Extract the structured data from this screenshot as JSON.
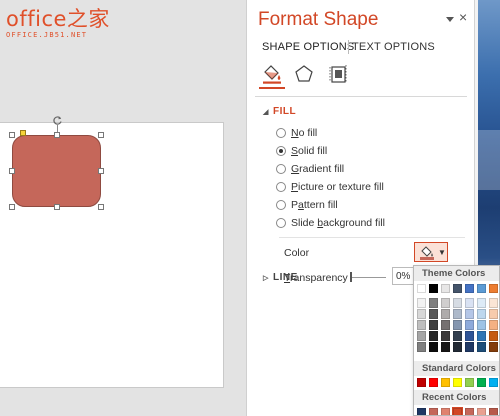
{
  "watermark": {
    "main": "office之家",
    "sub": "OFFICE.JB51.NET"
  },
  "pane": {
    "title": "Format Shape",
    "close_glyph": "×",
    "tabs": [
      {
        "label": "SHAPE OPTIONS",
        "active": true
      },
      {
        "label": "TEXT OPTIONS",
        "active": false
      }
    ],
    "category_icons": [
      "fill-line-icon",
      "effects-pentagon-icon",
      "size-properties-icon"
    ]
  },
  "fill": {
    "heading": "FILL",
    "options": [
      {
        "pre": "",
        "u": "N",
        "post": "o fill",
        "selected": false
      },
      {
        "pre": "",
        "u": "S",
        "post": "olid fill",
        "selected": true
      },
      {
        "pre": "",
        "u": "G",
        "post": "radient fill",
        "selected": false
      },
      {
        "pre": "",
        "u": "P",
        "post": "icture or texture fill",
        "selected": false
      },
      {
        "pre": "P",
        "u": "a",
        "post": "ttern fill",
        "selected": false
      },
      {
        "pre": "Slide ",
        "u": "b",
        "post": "ackground fill",
        "selected": false
      }
    ],
    "color_label": "Color",
    "transparency": {
      "label_u": "T",
      "label_rest": "ransparency",
      "value": "0%",
      "level": 0
    }
  },
  "line": {
    "heading": "LINE"
  },
  "picker": {
    "theme_heading": "Theme Colors",
    "standard_heading": "Standard Colors",
    "recent_heading": "Recent Colors",
    "theme_top": [
      "#ffffff",
      "#000000",
      "#e7e6e6",
      "#44546a",
      "#4472c4",
      "#5b9bd5",
      "#ed7d31"
    ],
    "theme_shades": [
      [
        "#f2f2f2",
        "#7f7f7f",
        "#d0cece",
        "#d6dce4",
        "#d9e2f3",
        "#ddebf7",
        "#fbe5d5"
      ],
      [
        "#d8d8d8",
        "#595959",
        "#aeabab",
        "#adb9ca",
        "#b4c6e7",
        "#bdd7ee",
        "#f7cbac"
      ],
      [
        "#bfbfbf",
        "#3f3f3f",
        "#757070",
        "#8496b0",
        "#8eaadb",
        "#9dc3e6",
        "#f4b183"
      ],
      [
        "#a5a5a5",
        "#262626",
        "#3a3838",
        "#323f4f",
        "#2f5496",
        "#2e75b5",
        "#c55a11"
      ],
      [
        "#7f7f7f",
        "#0c0c0c",
        "#171616",
        "#222a35",
        "#1f3864",
        "#1e4e79",
        "#833c0b"
      ]
    ],
    "standard": [
      "#c00000",
      "#ff0000",
      "#ffc000",
      "#ffff00",
      "#92d050",
      "#00b050",
      "#00b0f0"
    ],
    "recent": [
      "#1f3864",
      "#c5675a",
      "#e0826f",
      "#d24726",
      "#c5675a",
      "#e8a090",
      "#b85a4a"
    ],
    "recent_selected_index": 3
  },
  "colors": {
    "accent": "#d24726",
    "shape_fill": "#c5675a",
    "shape_border": "#8f4a40"
  }
}
